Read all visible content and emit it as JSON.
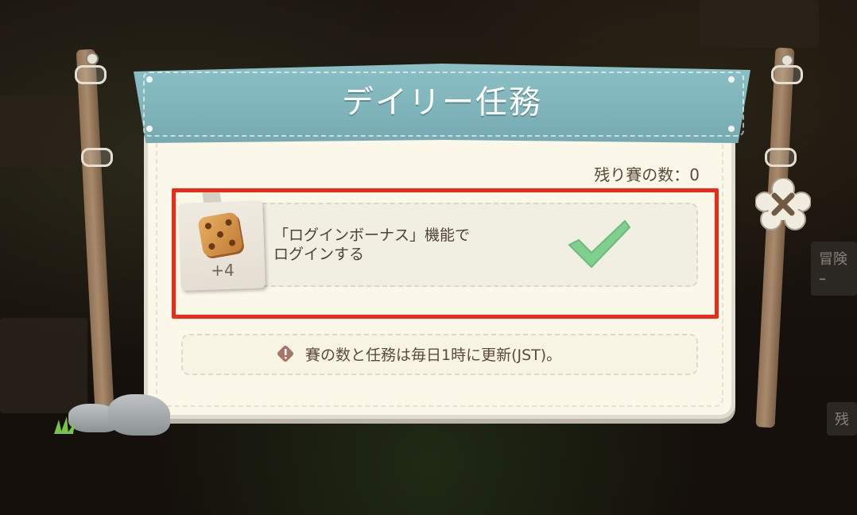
{
  "dialog": {
    "title": "デイリー任務",
    "remaining_label": "残り賽の数：0"
  },
  "task": {
    "reward_amount": "+4",
    "reward_icon": "dice-icon",
    "description_line1": "「ログインボーナス」機能で",
    "description_line2": "ログインする",
    "status_icon": "check-icon",
    "status_color": "#7fcf8e"
  },
  "info": {
    "icon": "warning-icon",
    "text": "賽の数と任務は毎日1時に更新(JST)。"
  },
  "close": {
    "icon": "close-icon"
  },
  "background": {
    "right_label_1": "冒険ｰ",
    "right_label_2": "残"
  },
  "colors": {
    "banner": "#7fb4b9",
    "panel": "#fbf8ea",
    "highlight": "#ee2a17"
  }
}
